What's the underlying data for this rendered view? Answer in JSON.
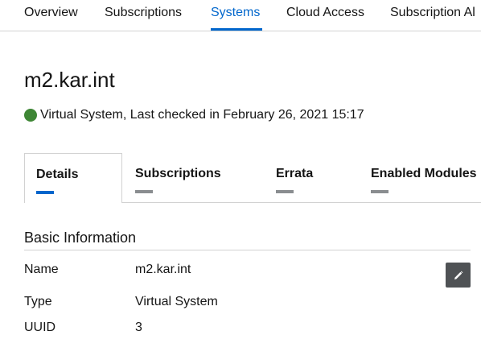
{
  "topnav": {
    "items": [
      "Overview",
      "Subscriptions",
      "Systems",
      "Cloud Access",
      "Subscription Al"
    ],
    "active": "Systems"
  },
  "system": {
    "title": "m2.kar.int",
    "status_text": "Virtual System, Last checked in February 26, 2021 15:17",
    "status_color": "#3e8635"
  },
  "tabs": [
    "Details",
    "Subscriptions",
    "Errata",
    "Enabled Modules"
  ],
  "basic_info": {
    "title": "Basic Information",
    "name_label": "Name",
    "name_value": "m2.kar.int",
    "type_label": "Type",
    "type_value": "Virtual System",
    "uuid_label": "UUID",
    "uuid_value": "3"
  },
  "icons": {
    "edit": "pencil-icon",
    "status": "status-ok-icon"
  },
  "colors": {
    "accent": "#0066cc",
    "inactive_bar": "#8a8d90",
    "edit_button": "#4f5255"
  }
}
